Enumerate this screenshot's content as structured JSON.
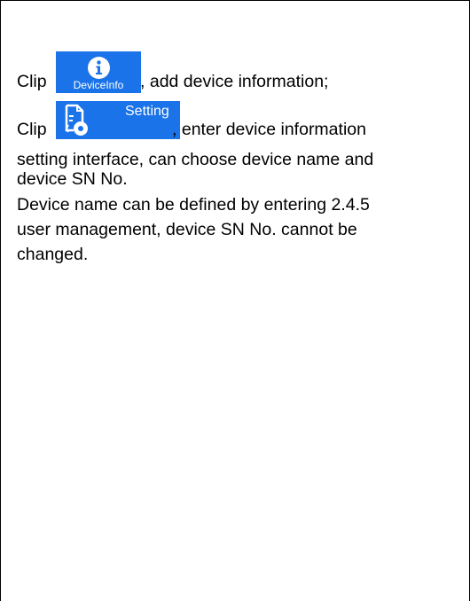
{
  "paragraph1": {
    "prefix": "Clip ",
    "button_label": "DeviceInfo",
    "suffix": ", add device information;"
  },
  "paragraph2": {
    "prefix": "Clip ",
    "button_label": "Setting",
    "suffix": ", enter device information",
    "line2": "setting interface, can choose device name and",
    "line3": "device SN No.",
    "line4": "Device name can be defined by entering 2.4.5",
    "line5": "user management, device SN No. cannot be",
    "line6": "changed."
  },
  "colors": {
    "icon_background": "#1a73e8",
    "icon_foreground": "#ffffff"
  }
}
